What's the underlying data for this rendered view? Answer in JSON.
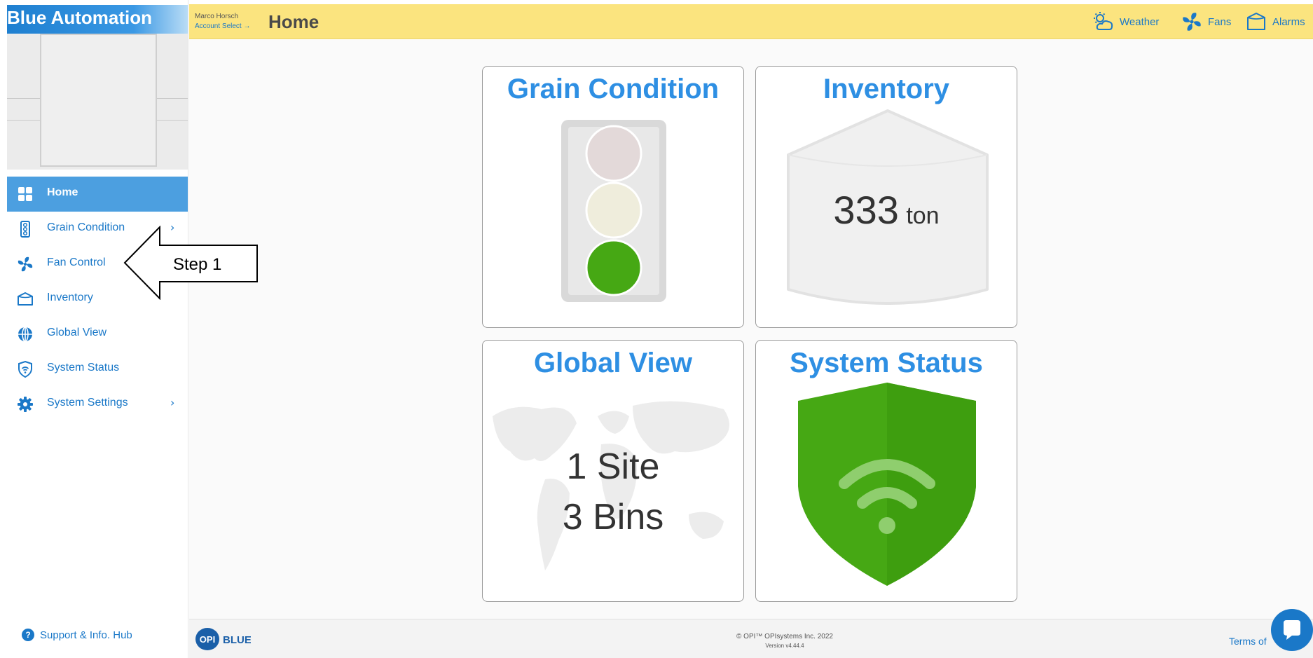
{
  "brand": {
    "title": "Blue Automation"
  },
  "sidebar": {
    "items": [
      {
        "label": "Home",
        "icon": "grid-icon",
        "active": true,
        "chevron": ""
      },
      {
        "label": "Grain Condition",
        "icon": "traffic-light-icon",
        "active": false,
        "chevron": "›"
      },
      {
        "label": "Fan Control",
        "icon": "fan-icon",
        "active": false,
        "chevron": ""
      },
      {
        "label": "Inventory",
        "icon": "bin-icon",
        "active": false,
        "chevron": ""
      },
      {
        "label": "Global View",
        "icon": "globe-icon",
        "active": false,
        "chevron": ""
      },
      {
        "label": "System Status",
        "icon": "shield-wifi-icon",
        "active": false,
        "chevron": ""
      },
      {
        "label": "System Settings",
        "icon": "gear-icon",
        "active": false,
        "chevron": "›"
      }
    ],
    "support_label": "Support & Info. Hub",
    "support_icon": "question-icon"
  },
  "header": {
    "user_name": "Marco Horsch",
    "account_select": "Account Select →",
    "page_title": "Home",
    "actions": [
      {
        "label": "Weather",
        "icon": "weather-icon"
      },
      {
        "label": "Fans",
        "icon": "fan-icon"
      },
      {
        "label": "Alarms",
        "icon": "bin-icon"
      }
    ]
  },
  "cards": {
    "grain": {
      "title": "Grain Condition",
      "status": "green"
    },
    "inventory": {
      "title": "Inventory",
      "value": "333",
      "unit": "ton"
    },
    "global": {
      "title": "Global View",
      "sites": "1 Site",
      "bins": "3 Bins"
    },
    "status": {
      "title": "System Status"
    }
  },
  "annotation": {
    "text": "Step 1"
  },
  "footer": {
    "logo_text": "OPI BLUE",
    "copyright": "© OPI™ OPIsystems Inc. 2022",
    "version": "Version v4.44.4",
    "terms": "Terms of"
  },
  "colors": {
    "accent": "#1a78c8",
    "title_blue": "#2e8fe3",
    "header_bg": "#fbe47f",
    "active_nav": "#4c9fe0",
    "status_green": "#46a814"
  }
}
